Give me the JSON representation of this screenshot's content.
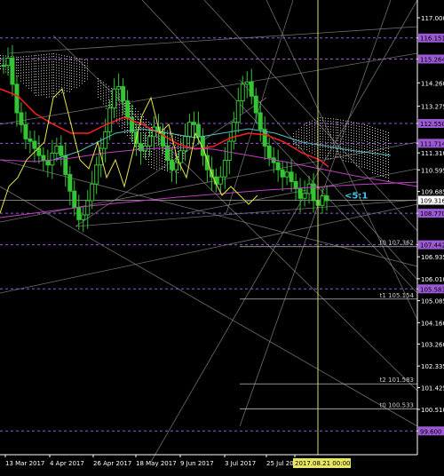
{
  "colors": {
    "background": "#000000",
    "bull_candle": "#34c434",
    "bear_candle": "#34c434",
    "axis": "#ffffff",
    "grid_line": "#8a8a8a",
    "purple_level": "#9b59d6",
    "purple_label_bg": "#9b59d6",
    "red_ma": "#ff2020",
    "yellow_line": "#e6e64a",
    "cyan_line": "#4fc3c3",
    "magenta_line": "#c040c0",
    "cloud_dots": "#d8c8c0",
    "current_price_label_bg": "#ffffff",
    "vertical_marker": "#d8d86a",
    "ratio_text": "#40c8e8"
  },
  "chart_data": {
    "type": "candlestick",
    "title": "",
    "ylim": [
      98.6,
      117.6
    ],
    "y_axis_ticks": [
      "117.000",
      "116.151",
      "115.264",
      "114.260",
      "113.275",
      "112.550",
      "111.714",
      "111.310",
      "110.595",
      "109.685",
      "108.770",
      "107.442",
      "106.935",
      "106.010",
      "105.583",
      "105.085",
      "104.160",
      "103.260",
      "102.335",
      "101.425",
      "100.510",
      "99.600"
    ],
    "x_axis_ticks": [
      "13 Mar 2017",
      "4 Apr 2017",
      "26 Apr 2017",
      "18 May 2017",
      "9 Jun 2017",
      "3 Jul 2017",
      "25 Jul 20",
      "2017.08.21 00:00"
    ],
    "current_price": "109.316",
    "purple_levels": [
      "116.151",
      "115.264",
      "112.550",
      "111.714",
      "108.770",
      "107.442",
      "105.583",
      "99.600"
    ],
    "level_tags": [
      {
        "text": "t0 107.362",
        "value": 107.362
      },
      {
        "text": "t1 105.154",
        "value": 105.154
      },
      {
        "text": "t2 101.583",
        "value": 101.583
      },
      {
        "text": "t0 100.533",
        "value": 100.533
      }
    ],
    "ratio_text": "<5:1",
    "closes": [
      115.0,
      115.3,
      114.2,
      113.0,
      112.5,
      111.9,
      111.8,
      111.5,
      111.2,
      111.0,
      110.8,
      111.3,
      111.6,
      111.2,
      110.4,
      109.7,
      109.0,
      108.5,
      108.7,
      109.3,
      110.0,
      110.8,
      111.5,
      112.2,
      113.2,
      114.0,
      114.1,
      113.5,
      112.8,
      112.2,
      111.7,
      111.4,
      111.6,
      112.0,
      112.4,
      112.2,
      111.6,
      111.0,
      110.6,
      110.9,
      111.4,
      112.0,
      112.6,
      112.5,
      112.0,
      111.2,
      110.6,
      110.3,
      110.0,
      110.3,
      111.0,
      111.8,
      112.6,
      113.5,
      114.2,
      114.3,
      113.7,
      113.0,
      112.3,
      111.6,
      111.1,
      110.9,
      110.6,
      110.3,
      110.5,
      110.1,
      109.8,
      109.4,
      109.6,
      110.0,
      109.3,
      109.1,
      109.5,
      109.3
    ]
  },
  "window": {
    "title_bar": ""
  }
}
